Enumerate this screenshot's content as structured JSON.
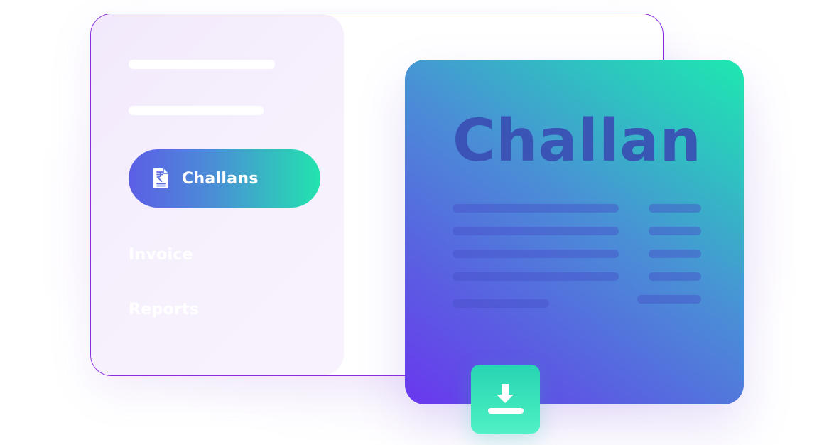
{
  "sidebar": {
    "active_item": {
      "label": "Challans",
      "icon": "rupee-document-icon"
    },
    "items": [
      {
        "label": "Invoice"
      },
      {
        "label": "Reports"
      }
    ]
  },
  "card": {
    "title": "Challan",
    "download_icon": "download-icon"
  },
  "colors": {
    "window_border": "#8b2be0",
    "sidebar_bg": "#f4ecfc",
    "accent_start": "#5c5ee6",
    "accent_end": "#22e3ad",
    "card_title": "#3a4fb4",
    "download_bg": "#3ee6bb"
  }
}
